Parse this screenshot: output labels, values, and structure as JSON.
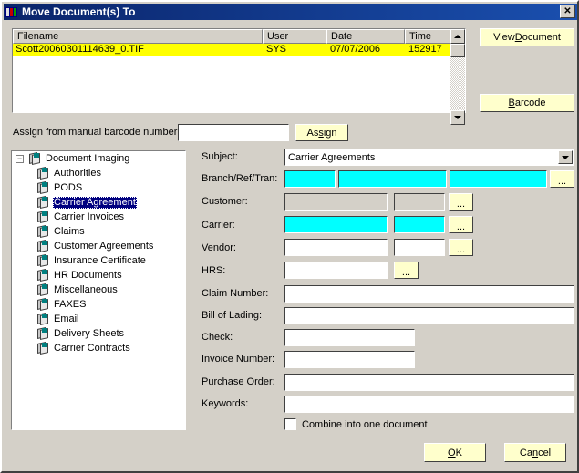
{
  "window": {
    "title": "Move Document(s) To",
    "app_icon": "document-stack-icon",
    "close_label": "✕",
    "titlebar_color": "#0a246a"
  },
  "filelist": {
    "columns": [
      "Filename",
      "User",
      "Date",
      "Time"
    ],
    "rows": [
      {
        "filename": "Scott20060301114639_0.TIF",
        "user": "SYS",
        "date": "07/07/2006",
        "time": "152917",
        "selected": true
      }
    ],
    "selection_color": "#ffff00",
    "scrollbar": {
      "up_icon": "arrow-up-icon",
      "down_icon": "arrow-down-icon"
    }
  },
  "buttons": {
    "view_document": {
      "pre": "View ",
      "acc": "D",
      "post": "ocument"
    },
    "barcode": {
      "pre": "",
      "acc": "B",
      "post": "arcode"
    },
    "assign": {
      "pre": "As",
      "acc": "s",
      "post": "ign"
    },
    "ok": {
      "pre": "",
      "acc": "O",
      "post": "K"
    },
    "cancel": {
      "pre": "Ca",
      "acc": "n",
      "post": "cel"
    },
    "browse_label": "...",
    "button_color": "#ffffcc"
  },
  "barcode_row": {
    "label": "Assign from manual barcode number:",
    "value": "",
    "placeholder": ""
  },
  "tree": {
    "root": {
      "label": "Document Imaging",
      "expander": "−"
    },
    "items": [
      {
        "label": "Authorities",
        "selected": false
      },
      {
        "label": "PODS",
        "selected": false
      },
      {
        "label": "Carrier Agreement",
        "selected": true
      },
      {
        "label": "Carrier Invoices",
        "selected": false
      },
      {
        "label": "Claims",
        "selected": false
      },
      {
        "label": "Customer Agreements",
        "selected": false
      },
      {
        "label": "Insurance Certificate",
        "selected": false
      },
      {
        "label": "HR Documents",
        "selected": false
      },
      {
        "label": "Miscellaneous",
        "selected": false
      },
      {
        "label": "FAXES",
        "selected": false
      },
      {
        "label": "Email",
        "selected": false
      },
      {
        "label": "Delivery Sheets",
        "selected": false
      },
      {
        "label": "Carrier Contracts",
        "selected": false
      }
    ],
    "selection_color": "#000080"
  },
  "form": {
    "subject": {
      "label": "Subject:",
      "value": "Carrier Agreements",
      "arrow_icon": "chevron-down-icon"
    },
    "branch": {
      "label": "Branch/Ref/Tran:",
      "v1": "",
      "v2": "",
      "v3": ""
    },
    "customer": {
      "label": "Customer:",
      "v1": "",
      "v2": ""
    },
    "carrier": {
      "label": "Carrier:",
      "v1": "",
      "v2": ""
    },
    "vendor": {
      "label": "Vendor:",
      "v1": "",
      "v2": ""
    },
    "hrs": {
      "label": "HRS:",
      "v1": ""
    },
    "claim_number": {
      "label": "Claim Number:",
      "value": ""
    },
    "bill_of_lading": {
      "label": "Bill of Lading:",
      "value": ""
    },
    "check": {
      "label": "Check:",
      "value": ""
    },
    "invoice_number": {
      "label": "Invoice Number:",
      "value": ""
    },
    "purchase_order": {
      "label": "Purchase Order:",
      "value": ""
    },
    "keywords": {
      "label": "Keywords:",
      "value": ""
    },
    "combine": {
      "label": "Combine into one document",
      "checked": false
    },
    "highlight_color": "#00ffff"
  }
}
